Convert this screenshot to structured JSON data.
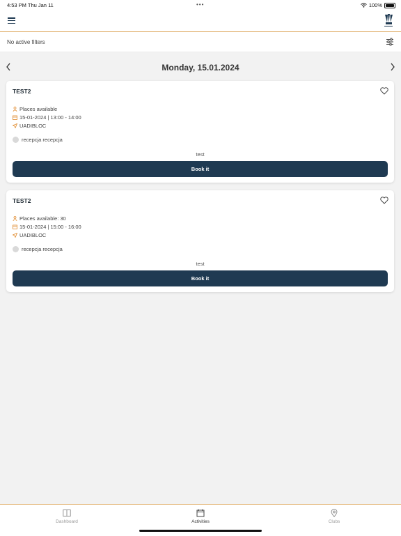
{
  "status": {
    "time_date": "4:53 PM   Thu Jan 11",
    "dots": "•••",
    "battery_text": "100%"
  },
  "appbar": {
    "menu_icon": "hamburger-icon",
    "logo_icon": "club-logo-icon"
  },
  "filters": {
    "text": "No active filters",
    "icon": "sliders-icon"
  },
  "date_nav": {
    "title": "Monday, 15.01.2024",
    "prev_icon": "chevron-left-icon",
    "next_icon": "chevron-right-icon"
  },
  "activities": [
    {
      "name": "TEST2",
      "places": "Places available",
      "datetime": "15-01-2024 | 13:00 - 14:00",
      "location": "UADIBLOC",
      "instructor": "recepcja recepcja",
      "description": "test",
      "book_label": "Book it"
    },
    {
      "name": "TEST2",
      "places": "Places available: 30",
      "datetime": "15-01-2024 | 15:00 - 16:00",
      "location": "UADIBLOC",
      "instructor": "recepcja recepcja",
      "description": "test",
      "book_label": "Book it"
    }
  ],
  "tabs": [
    {
      "label": "Dashboard",
      "icon": "book-icon",
      "active": false
    },
    {
      "label": "Activities",
      "icon": "calendar-icon",
      "active": true
    },
    {
      "label": "Clubs",
      "icon": "map-pin-icon",
      "active": false
    }
  ],
  "colors": {
    "accent": "#e0b06c",
    "primary": "#1f3a52",
    "icon_orange": "#e08a2c"
  }
}
